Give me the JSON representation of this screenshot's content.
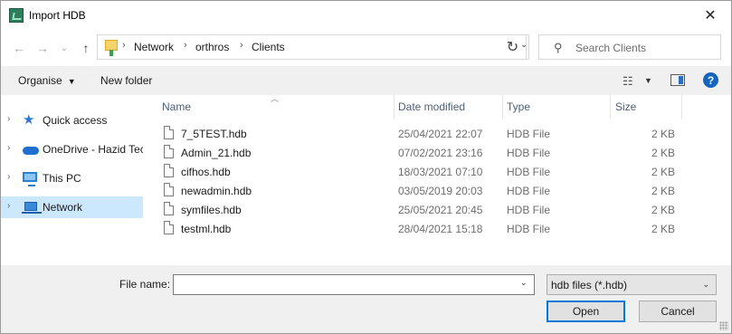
{
  "window": {
    "title": "Import HDB",
    "close_glyph": "✕"
  },
  "nav": {
    "back_glyph": "←",
    "forward_glyph": "→",
    "recent_glyph": "⌄",
    "up_glyph": "↑",
    "breadcrumbs": [
      "Network",
      "orthros",
      "Clients"
    ],
    "crumb_separator": "›",
    "address_dropdown_glyph": "⌄",
    "refresh_glyph": "↻",
    "search_placeholder": "Search Clients",
    "search_glyph": "⚲"
  },
  "toolbar": {
    "organise_label": "Organise",
    "new_folder_label": "New folder",
    "help_glyph": "?",
    "view_glyph": "☷"
  },
  "sidebar": {
    "items": [
      {
        "label": "Quick access",
        "icon": "star-icon"
      },
      {
        "label": "OneDrive - Hazid Tec",
        "icon": "cloud-icon"
      },
      {
        "label": "This PC",
        "icon": "computer-icon"
      },
      {
        "label": "Network",
        "icon": "network-icon",
        "selected": true
      }
    ]
  },
  "filelist": {
    "columns": {
      "name": "Name",
      "date": "Date modified",
      "type": "Type",
      "size": "Size"
    },
    "rows": [
      {
        "name": "7_5TEST.hdb",
        "date": "25/04/2021 22:07",
        "type": "HDB File",
        "size": "2 KB"
      },
      {
        "name": "Admin_21.hdb",
        "date": "07/02/2021 23:16",
        "type": "HDB File",
        "size": "2 KB"
      },
      {
        "name": "cifhos.hdb",
        "date": "18/03/2021 07:10",
        "type": "HDB File",
        "size": "2 KB"
      },
      {
        "name": "newadmin.hdb",
        "date": "03/05/2019 20:03",
        "type": "HDB File",
        "size": "2 KB"
      },
      {
        "name": "symfiles.hdb",
        "date": "25/05/2021 20:45",
        "type": "HDB File",
        "size": "2 KB"
      },
      {
        "name": "testml.hdb",
        "date": "28/04/2021 15:18",
        "type": "HDB File",
        "size": "2 KB"
      }
    ]
  },
  "footer": {
    "file_name_label": "File name:",
    "file_name_value": "",
    "file_type_value": "hdb files (*.hdb)",
    "open_label": "Open",
    "cancel_label": "Cancel"
  },
  "colors": {
    "selected_bg": "#cce8ff",
    "accent": "#0078d7",
    "header_text": "#4c607a"
  }
}
